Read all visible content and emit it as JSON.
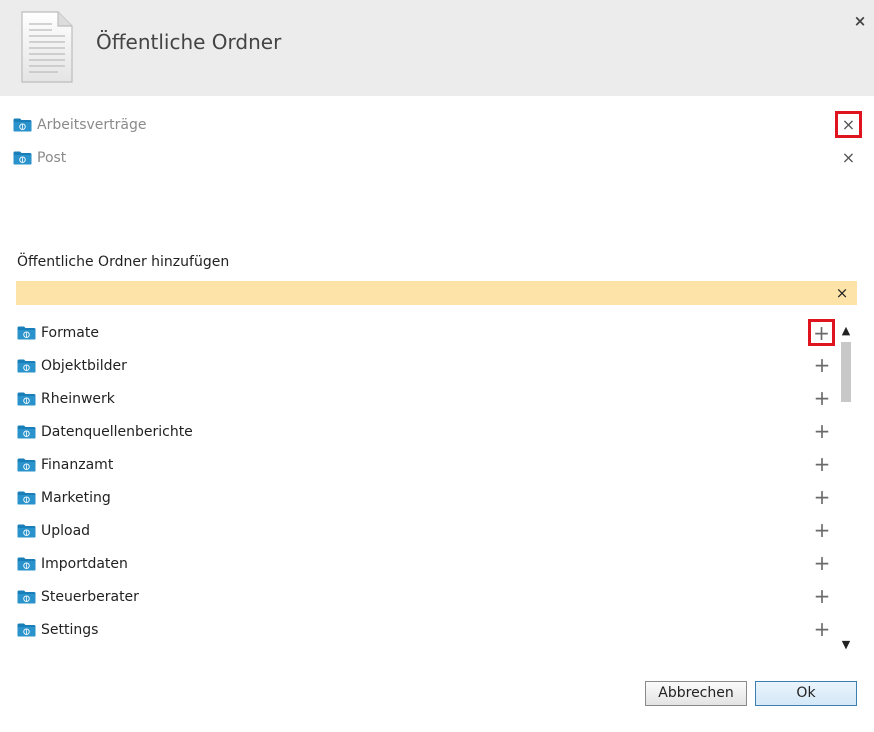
{
  "dialog": {
    "title": "Öffentliche Ordner",
    "close_glyph": "×",
    "icon": "document-icon"
  },
  "selected_folders": [
    {
      "label": "Arbeitsverträge",
      "remove_glyph": "×",
      "highlighted": true
    },
    {
      "label": "Post",
      "remove_glyph": "×",
      "highlighted": false
    }
  ],
  "add_section": {
    "label": "Öffentliche Ordner hinzufügen",
    "search_value": "",
    "search_placeholder": "",
    "clear_glyph": "×",
    "search_bg": "#fde3a7"
  },
  "available_folders": [
    {
      "label": "Formate",
      "add_glyph": "+",
      "highlighted": true
    },
    {
      "label": "Objektbilder",
      "add_glyph": "+",
      "highlighted": false
    },
    {
      "label": "Rheinwerk",
      "add_glyph": "+",
      "highlighted": false
    },
    {
      "label": "Datenquellenberichte",
      "add_glyph": "+",
      "highlighted": false
    },
    {
      "label": "Finanzamt",
      "add_glyph": "+",
      "highlighted": false
    },
    {
      "label": "Marketing",
      "add_glyph": "+",
      "highlighted": false
    },
    {
      "label": "Upload",
      "add_glyph": "+",
      "highlighted": false
    },
    {
      "label": "Importdaten",
      "add_glyph": "+",
      "highlighted": false
    },
    {
      "label": "Steuerberater",
      "add_glyph": "+",
      "highlighted": false
    },
    {
      "label": "Settings",
      "add_glyph": "+",
      "highlighted": false
    }
  ],
  "scrollbar": {
    "up_glyph": "▲",
    "down_glyph": "▼"
  },
  "buttons": {
    "cancel": "Abbrechen",
    "ok": "Ok"
  },
  "colors": {
    "highlight": "#e0141e",
    "folder": "#1a7fb8",
    "header_bg": "#ececec"
  }
}
